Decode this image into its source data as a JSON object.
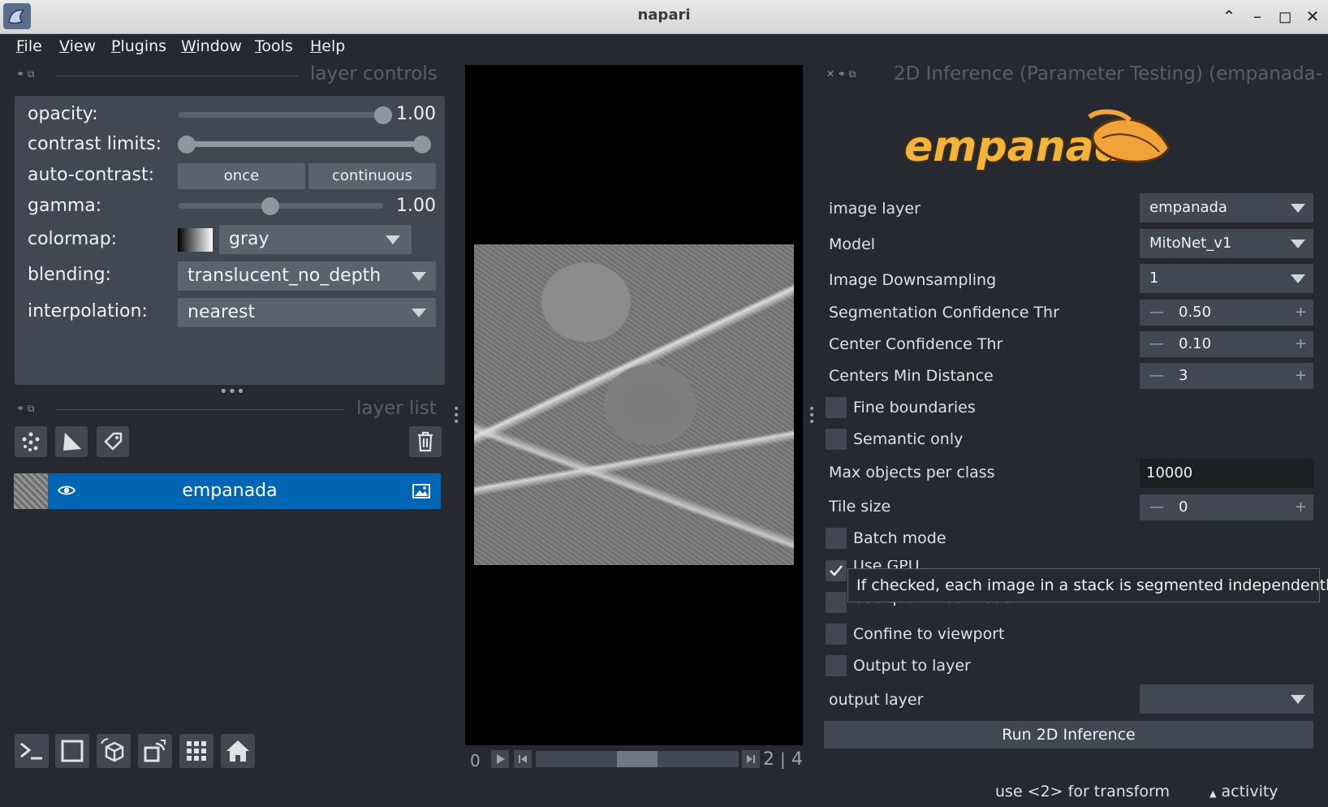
{
  "window": {
    "title": "napari"
  },
  "menu": [
    {
      "label": "File",
      "u": "F",
      "rest": "ile"
    },
    {
      "label": "View",
      "u": "V",
      "rest": "iew"
    },
    {
      "label": "Plugins",
      "u": "P",
      "rest": "lugins"
    },
    {
      "label": "Window",
      "u": "W",
      "rest": "indow"
    },
    {
      "label": "Tools",
      "u": "T",
      "rest": "ools"
    },
    {
      "label": "Help",
      "u": "H",
      "rest": "elp"
    }
  ],
  "layer_controls": {
    "title": "layer controls",
    "opacity": {
      "label": "opacity:",
      "value": "1.00",
      "fraction": 1.0
    },
    "contrast_limits": {
      "label": "contrast limits:",
      "low": 0.0,
      "high": 1.0
    },
    "auto_contrast": {
      "label": "auto-contrast:",
      "once": "once",
      "continuous": "continuous"
    },
    "gamma": {
      "label": "gamma:",
      "value": "1.00",
      "fraction": 0.45
    },
    "colormap": {
      "label": "colormap:",
      "value": "gray"
    },
    "blending": {
      "label": "blending:",
      "value": "translucent_no_depth"
    },
    "interpolation": {
      "label": "interpolation:",
      "value": "nearest"
    }
  },
  "layer_list": {
    "title": "layer list",
    "layers": [
      {
        "name": "empanada"
      }
    ]
  },
  "dims": {
    "frame": "0",
    "current": "2",
    "separator": "|",
    "total": "4",
    "slider_fraction": 0.5
  },
  "plugin": {
    "title": "2D Inference (Parameter Testing) (empanada-",
    "logo_text": "empanada",
    "image_layer": {
      "label": "image layer",
      "value": "empanada"
    },
    "model": {
      "label": "Model",
      "value": "MitoNet_v1"
    },
    "downsampling": {
      "label": "Image Downsampling",
      "value": "1"
    },
    "seg_conf": {
      "label": "Segmentation Confidence Thr",
      "value": "0.50"
    },
    "center_conf": {
      "label": "Center Confidence Thr",
      "value": "0.10"
    },
    "min_distance": {
      "label": "Centers Min Distance",
      "value": "3"
    },
    "fine_boundaries": {
      "label": "Fine boundaries",
      "checked": false
    },
    "semantic_only": {
      "label": "Semantic only",
      "checked": false
    },
    "max_objects": {
      "label": "Max objects per class",
      "value": "10000"
    },
    "tile_size": {
      "label": "Tile size",
      "value": "0"
    },
    "batch_mode": {
      "label": "Batch mode",
      "checked": false
    },
    "use_gpu": {
      "label": "Use GPU",
      "checked": true
    },
    "quantized": {
      "label": "Use quantized model",
      "checked": false
    },
    "confine": {
      "label": "Confine to viewport",
      "checked": false
    },
    "output_to_layer": {
      "label": "Output to layer",
      "checked": false
    },
    "output_layer": {
      "label": "output layer",
      "value": ""
    },
    "run_button": "Run 2D Inference",
    "tooltip": "If checked, each image in a stack is segmented independently."
  },
  "status": {
    "message": "use <2> for transform",
    "activity": "activity"
  }
}
